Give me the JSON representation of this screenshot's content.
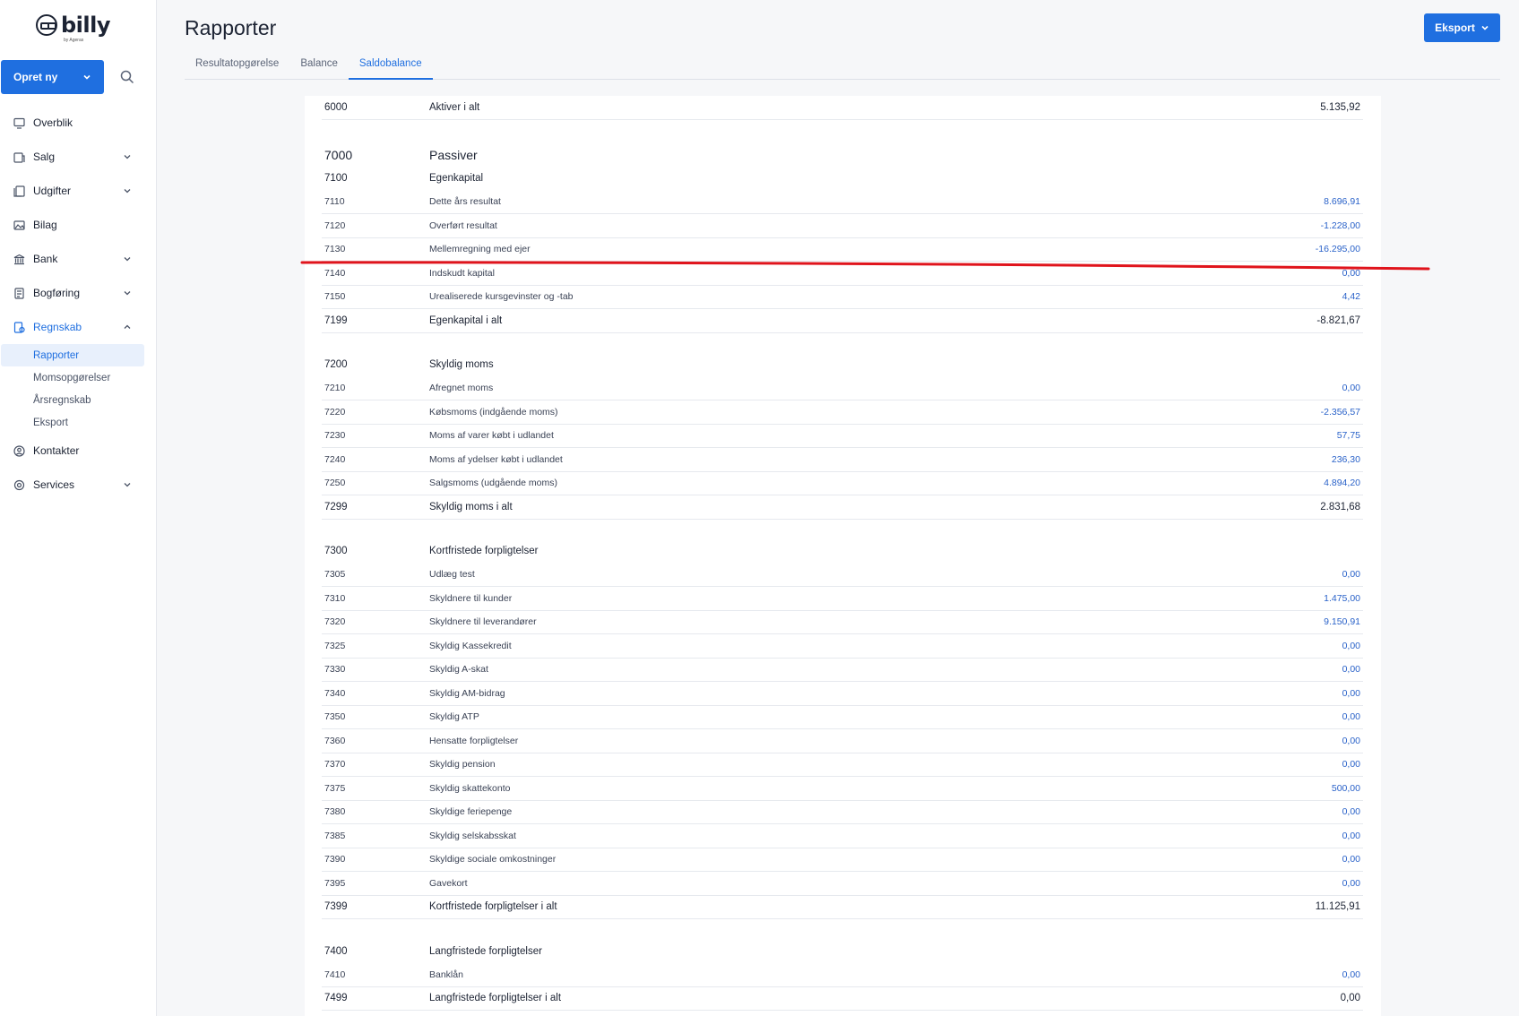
{
  "brand": {
    "name": "billy",
    "sub": "by Ageras"
  },
  "sidebar": {
    "create_label": "Opret ny",
    "items": [
      {
        "label": "Overblik",
        "icon": "overview-icon",
        "chevron": false
      },
      {
        "label": "Salg",
        "icon": "sales-icon",
        "chevron": true
      },
      {
        "label": "Udgifter",
        "icon": "expenses-icon",
        "chevron": true
      },
      {
        "label": "Bilag",
        "icon": "receipt-icon",
        "chevron": false
      },
      {
        "label": "Bank",
        "icon": "bank-icon",
        "chevron": true
      },
      {
        "label": "Bogføring",
        "icon": "bookkeeping-icon",
        "chevron": true
      },
      {
        "label": "Regnskab",
        "icon": "accounting-icon",
        "chevron": true
      }
    ],
    "subitems": [
      "Rapporter",
      "Momsopgørelser",
      "Årsregnskab",
      "Eksport"
    ],
    "bottom_items": [
      {
        "label": "Kontakter",
        "icon": "contacts-icon"
      },
      {
        "label": "Services",
        "icon": "services-icon"
      }
    ]
  },
  "header": {
    "title": "Rapporter",
    "export_label": "Eksport"
  },
  "tabs": [
    "Resultatopgørelse",
    "Balance",
    "Saldobalance"
  ],
  "report": {
    "top": {
      "num": "6000",
      "name": "Aktiver i alt",
      "val": "5.135,92"
    },
    "section": {
      "num": "7000",
      "name": "Passiver"
    },
    "groups": [
      {
        "num": "7100",
        "name": "Egenkapital",
        "rows": [
          {
            "num": "7110",
            "name": "Dette års resultat",
            "val": "8.696,91"
          },
          {
            "num": "7120",
            "name": "Overført resultat",
            "val": "-1.228,00"
          },
          {
            "num": "7130",
            "name": "Mellemregning med ejer",
            "val": "-16.295,00"
          },
          {
            "num": "7140",
            "name": "Indskudt kapital",
            "val": "0,00"
          },
          {
            "num": "7150",
            "name": "Urealiserede kursgevinster og -tab",
            "val": "4,42"
          }
        ],
        "total": {
          "num": "7199",
          "name": "Egenkapital i alt",
          "val": "-8.821,67"
        }
      },
      {
        "num": "7200",
        "name": "Skyldig moms",
        "rows": [
          {
            "num": "7210",
            "name": "Afregnet moms",
            "val": "0,00"
          },
          {
            "num": "7220",
            "name": "Købsmoms (indgående moms)",
            "val": "-2.356,57"
          },
          {
            "num": "7230",
            "name": "Moms af varer købt i udlandet",
            "val": "57,75"
          },
          {
            "num": "7240",
            "name": "Moms af ydelser købt i udlandet",
            "val": "236,30"
          },
          {
            "num": "7250",
            "name": "Salgsmoms (udgående moms)",
            "val": "4.894,20"
          }
        ],
        "total": {
          "num": "7299",
          "name": "Skyldig moms i alt",
          "val": "2.831,68"
        }
      },
      {
        "num": "7300",
        "name": "Kortfristede forpligtelser",
        "rows": [
          {
            "num": "7305",
            "name": "Udlæg test",
            "val": "0,00"
          },
          {
            "num": "7310",
            "name": "Skyldnere til kunder",
            "val": "1.475,00"
          },
          {
            "num": "7320",
            "name": "Skyldnere til leverandører",
            "val": "9.150,91"
          },
          {
            "num": "7325",
            "name": "Skyldig Kassekredit",
            "val": "0,00"
          },
          {
            "num": "7330",
            "name": "Skyldig A-skat",
            "val": "0,00"
          },
          {
            "num": "7340",
            "name": "Skyldig AM-bidrag",
            "val": "0,00"
          },
          {
            "num": "7350",
            "name": "Skyldig ATP",
            "val": "0,00"
          },
          {
            "num": "7360",
            "name": "Hensatte forpligtelser",
            "val": "0,00"
          },
          {
            "num": "7370",
            "name": "Skyldig pension",
            "val": "0,00"
          },
          {
            "num": "7375",
            "name": "Skyldig skattekonto",
            "val": "500,00"
          },
          {
            "num": "7380",
            "name": "Skyldige feriepenge",
            "val": "0,00"
          },
          {
            "num": "7385",
            "name": "Skyldig selskabsskat",
            "val": "0,00"
          },
          {
            "num": "7390",
            "name": "Skyldige sociale omkostninger",
            "val": "0,00"
          },
          {
            "num": "7395",
            "name": "Gavekort",
            "val": "0,00"
          }
        ],
        "total": {
          "num": "7399",
          "name": "Kortfristede forpligtelser i alt",
          "val": "11.125,91"
        }
      },
      {
        "num": "7400",
        "name": "Langfristede forpligtelser",
        "rows": [
          {
            "num": "7410",
            "name": "Banklån",
            "val": "0,00"
          }
        ],
        "total": {
          "num": "7499",
          "name": "Langfristede forpligtelser i alt",
          "val": "0,00"
        }
      }
    ]
  },
  "colors": {
    "accent": "#1f6fe0",
    "annotation": "#e0141c"
  }
}
